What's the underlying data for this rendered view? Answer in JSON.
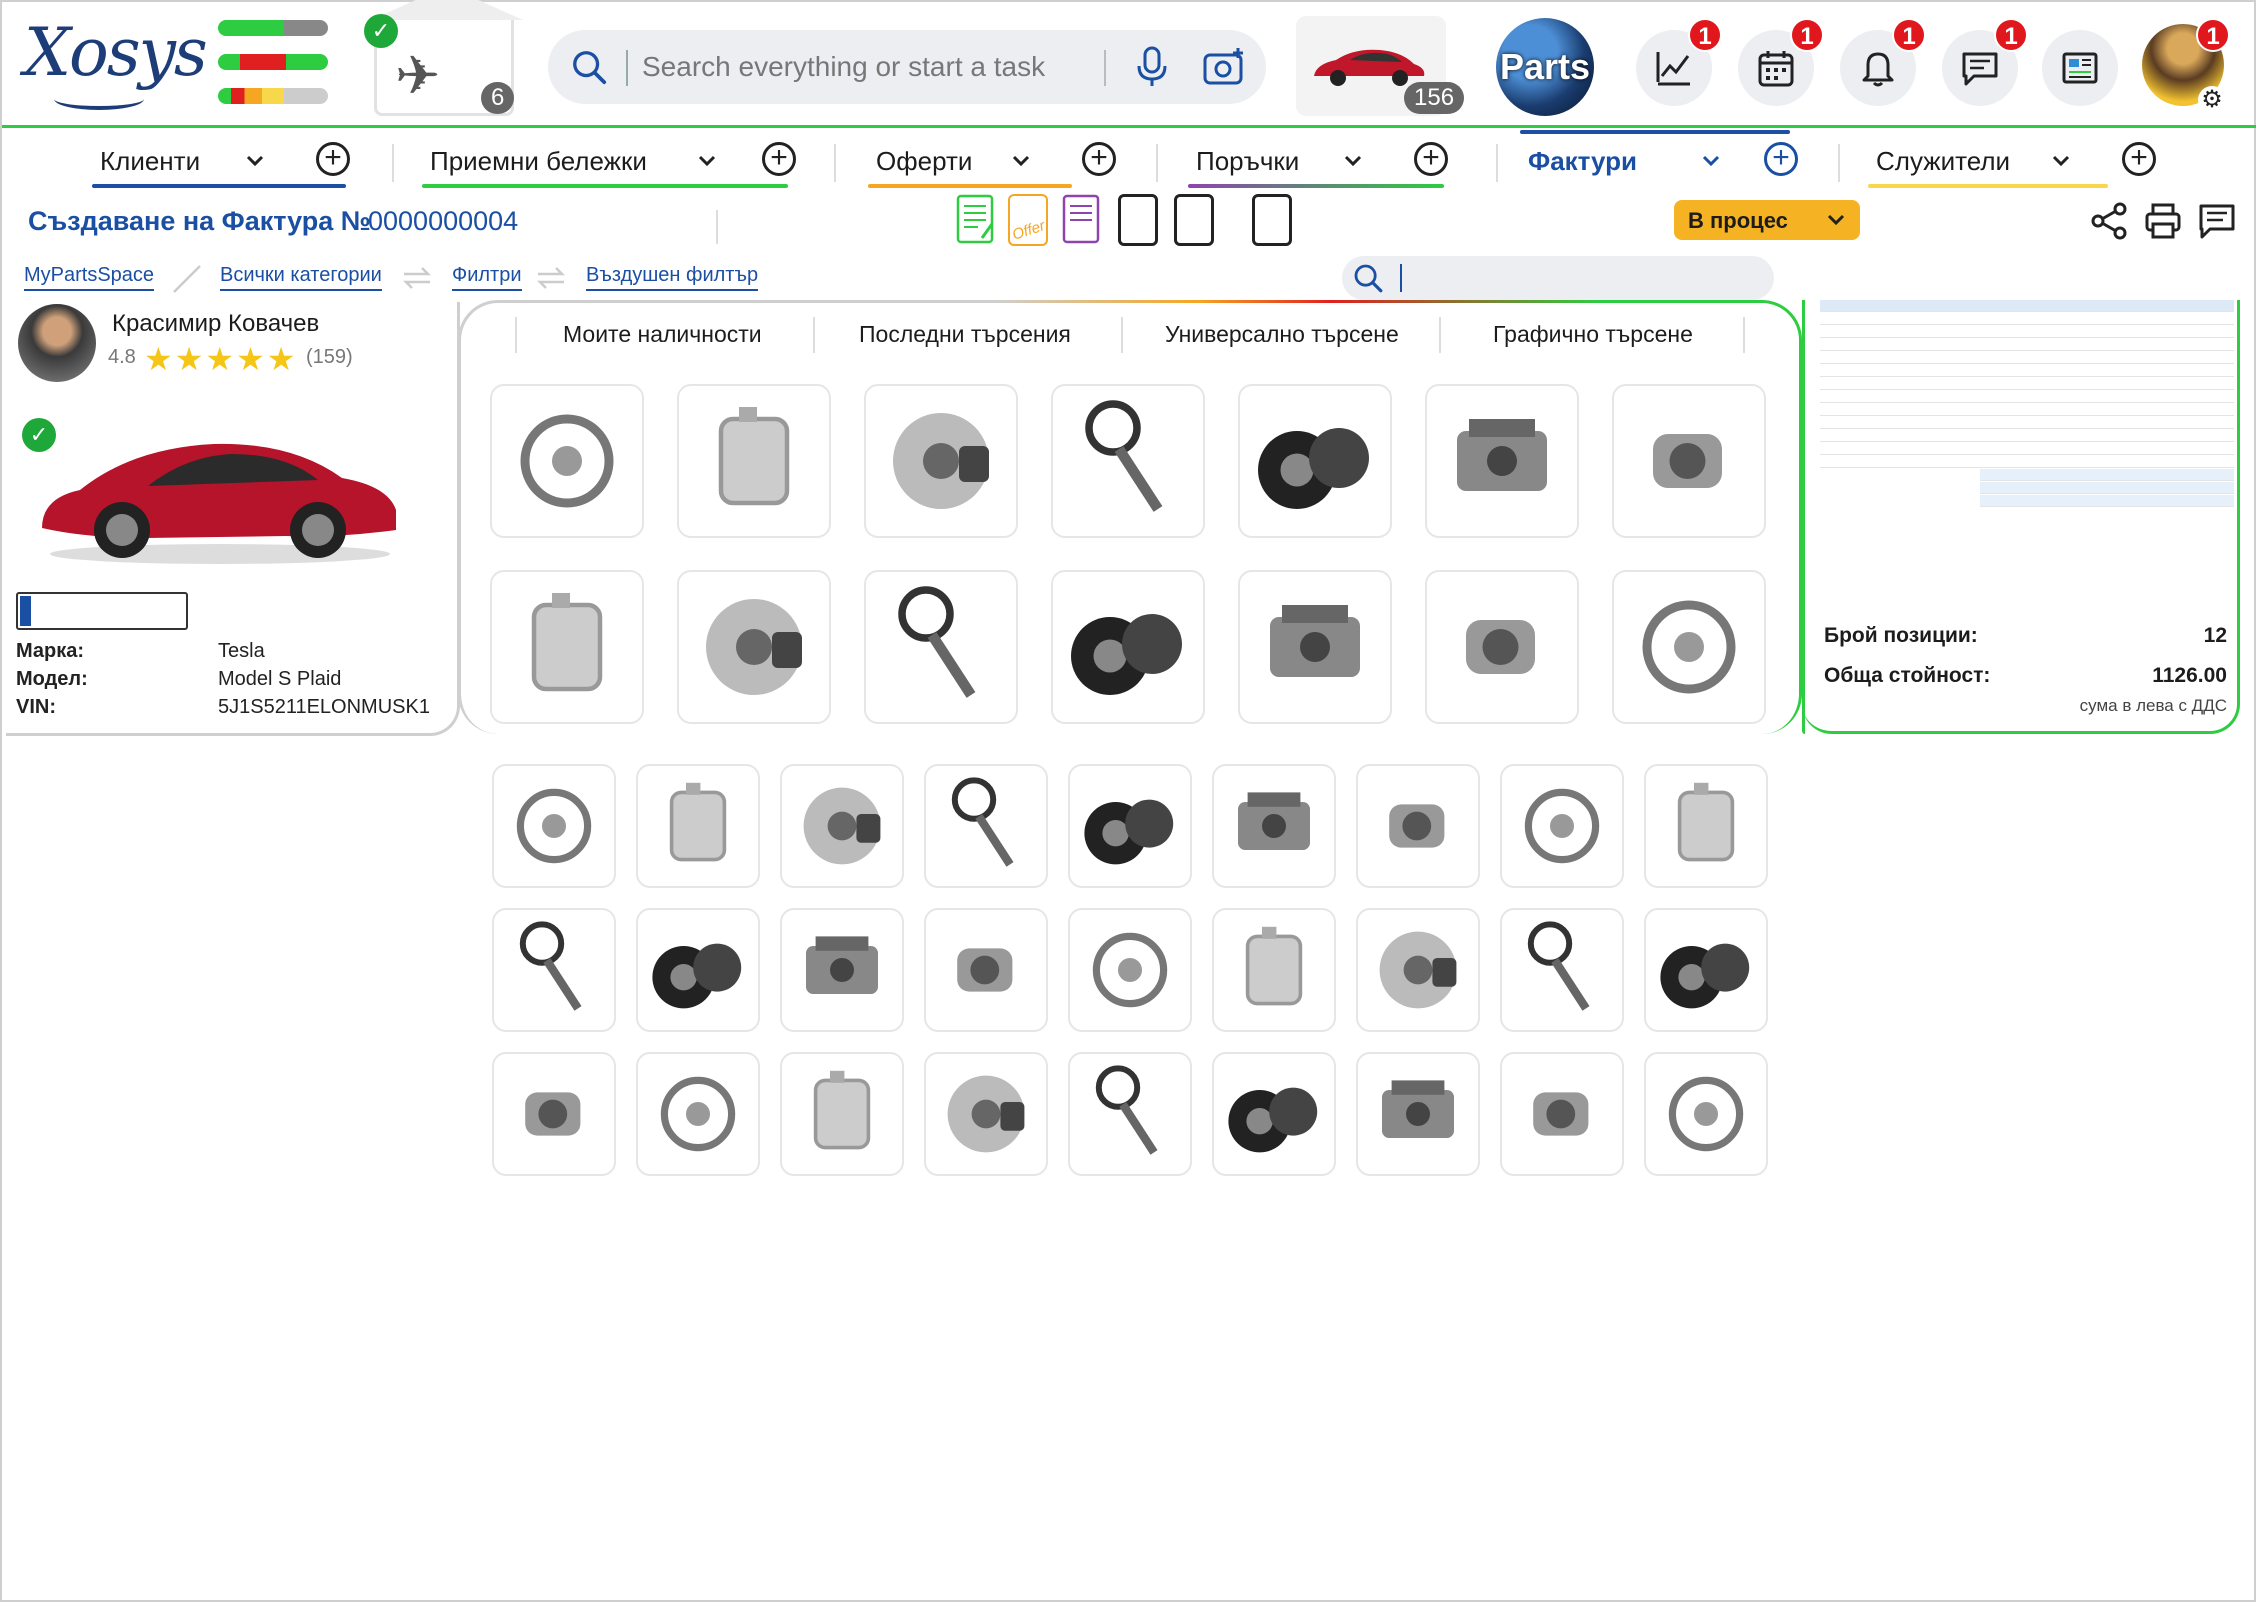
{
  "header": {
    "logo_text": "Xosys",
    "garage_count": "6",
    "search_placeholder": "Search everything or start a task",
    "car_count": "156",
    "parts_label": "Parts",
    "notifications": [
      "1",
      "1",
      "1",
      "1",
      "1"
    ]
  },
  "tabs": [
    {
      "label": "Клиенти",
      "color": "#1a4fa3"
    },
    {
      "label": "Приемни бележки",
      "color": "#2ecc40"
    },
    {
      "label": "Оферти",
      "color": "#f5a623"
    },
    {
      "label": "Поръчки",
      "color": "#8e44ad"
    },
    {
      "label": "Фактури",
      "color": "#1a4fa3",
      "active": true
    },
    {
      "label": "Служители",
      "color": "#f7d84b"
    }
  ],
  "document": {
    "title": "Създаване на Фактура №",
    "number": "0000000004",
    "offer_label": "Offer",
    "status": "В процес",
    "status_color": "#f5b323"
  },
  "breadcrumb": [
    "MyPartsSpace",
    "Всички категории",
    "Филтри",
    "Въздушен филтър"
  ],
  "customer": {
    "name": "Красимир Ковачев",
    "rating": "4.8",
    "stars": "★★★★★",
    "reviews": "(159)",
    "progress": 0.07,
    "brand_label": "Марка:",
    "brand": "Tesla",
    "model_label": "Модел:",
    "model": "Model S Plaid",
    "vin_label": "VIN:",
    "vin": "5J1S5211ELONMUSK1"
  },
  "category_tabs": [
    "Моите наличности",
    "Последни търсения",
    "Универсално търсене",
    "Графично търсене"
  ],
  "summary": {
    "positions_label": "Брой позиции:",
    "positions": "12",
    "total_label": "Обща стойност:",
    "total": "1126.00",
    "note": "сума в лева с ДДС"
  },
  "icons": {
    "search": "search-icon",
    "mic": "microphone-icon",
    "camera": "camera-search-icon",
    "stats": "chart-icon",
    "calendar": "calendar-icon",
    "bell": "bell-icon",
    "chat": "chat-icon",
    "news": "news-icon",
    "share": "share-icon",
    "print": "print-icon",
    "comment": "comment-icon"
  }
}
